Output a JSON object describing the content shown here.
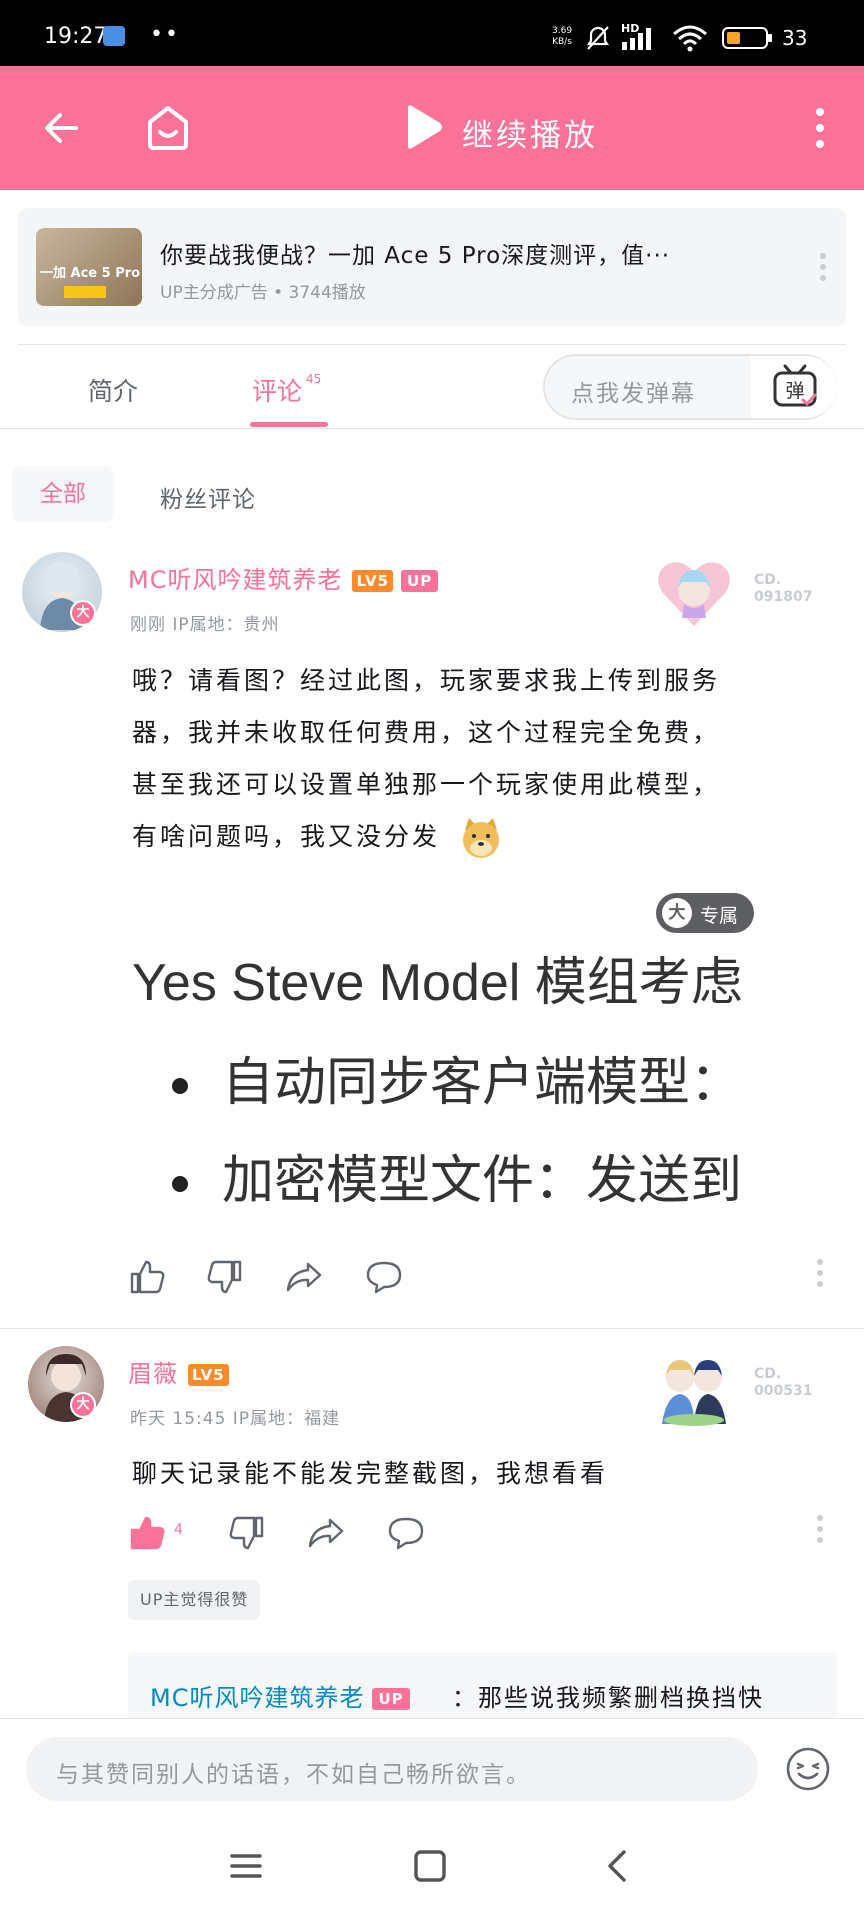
{
  "status_bar": {
    "time": "19:27",
    "net_speed_value": "3.69",
    "net_speed_unit": "KB/s",
    "network": "HD",
    "battery": "33"
  },
  "header": {
    "continue_label": "继续播放"
  },
  "ad": {
    "thumb_line1": "一加 Ace 5 Pro",
    "title": "你要战我便战？一加 Ace 5 Pro深度测评，值···",
    "meta": "UP主分成广告 • 3744播放"
  },
  "tabs": {
    "intro": "简介",
    "comments": "评论",
    "comments_count": "45"
  },
  "danmaku": {
    "placeholder": "点我发弹幕",
    "button_char": "弹"
  },
  "filters": {
    "all": "全部",
    "fans": "粉丝评论"
  },
  "comments": [
    {
      "username": "MC听风吟建筑养老",
      "level": "LV5",
      "up_badge": "UP",
      "avatar_badge": "大",
      "meta": "刚刚  IP属地：贵州",
      "fan_no_line1": "CD.",
      "fan_no_line2": "091807",
      "text_lines": [
        "哦？请看图？经过此图，玩家要求我上传到服务",
        "器，我并未收取任何费用，这个过程完全免费，",
        "甚至我还可以设置单独那一个玩家使用此模型，",
        "有啥问题吗，我又没分发"
      ],
      "image": {
        "line1": "Yes Steve Model 模组考虑",
        "bullet1": "自动同步客户端模型：",
        "bullet2": "加密模型文件：发送到"
      },
      "exclusive_icon": "大",
      "exclusive_label": "专属"
    },
    {
      "username": "眉薇",
      "level": "LV5",
      "avatar_badge": "大",
      "meta": "昨天  15:45  IP属地：福建",
      "fan_no_line1": "CD.",
      "fan_no_line2": "000531",
      "text": "聊天记录能不能发完整截图，我想看看",
      "like_count": "4",
      "up_favored": "UP主觉得很赞",
      "reply": {
        "username": "MC听风吟建筑养老",
        "up_badge": "UP",
        "text": "：那些说我频繁删档换挡快"
      }
    }
  ],
  "input": {
    "placeholder": "与其赞同别人的话语，不如自己畅所欲言。"
  },
  "colors": {
    "brand_pink": "#fb7299",
    "level_orange": "#ff8a2b",
    "reply_blue": "#008ac5"
  }
}
